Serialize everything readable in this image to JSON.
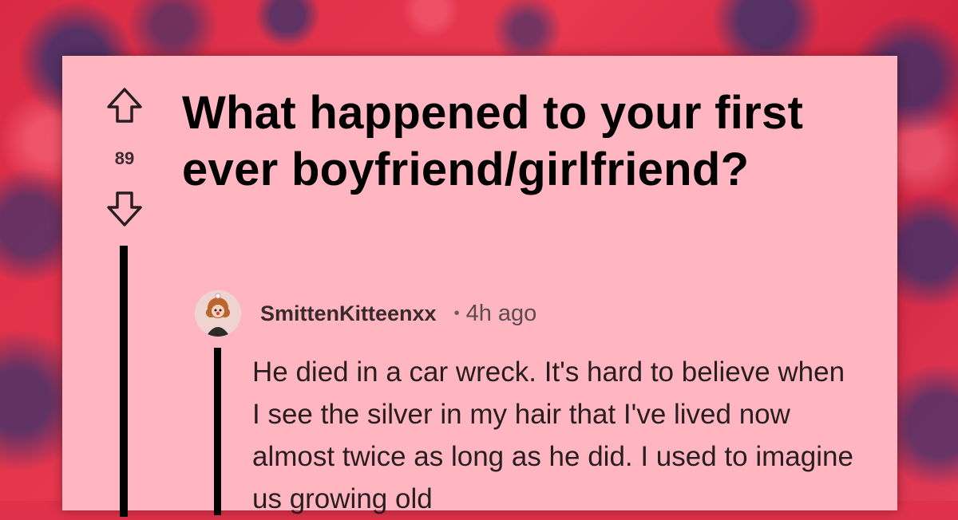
{
  "post": {
    "title": "What happened to your first ever boyfriend/girlfriend?",
    "vote_count": "89"
  },
  "comment": {
    "author": "SmittenKitteenxx",
    "separator": "•",
    "time": "4h ago",
    "body": "He died in a car wreck. It's hard to believe when I see the silver in my hair that I've lived now almost twice as long as he did. I used to imagine us growing old"
  },
  "colors": {
    "background": "#e0314a",
    "card": "#ffb6c1",
    "text": "#000000"
  },
  "icons": {
    "upvote": "arrow-up-icon",
    "downvote": "arrow-down-icon"
  }
}
